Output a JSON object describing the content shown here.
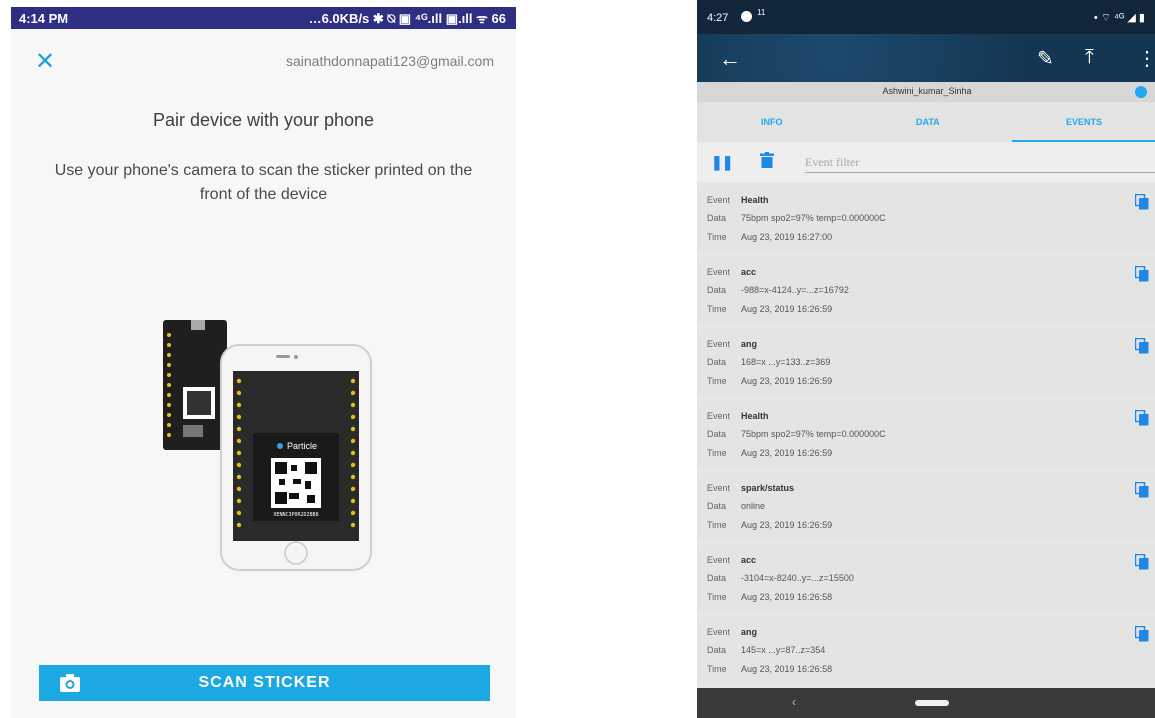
{
  "left_screen": {
    "status_bar": {
      "time": "4:14 PM",
      "right": "…6.0KB/s ✱ ⍉ ▣ ⁴ᴳ.ıll ▣.ıll ᯤ 66"
    },
    "account_email": "sainathdonnapati123@gmail.com",
    "title": "Pair device with your phone",
    "description": "Use your phone's camera to scan the sticker printed on the front of the device",
    "illustration": {
      "brand": "Particle",
      "code": "XENNC3P0R2D2BB8"
    },
    "scan_button_label": "SCAN STICKER",
    "accent": "#1ca8e3"
  },
  "right_screen": {
    "status_bar": {
      "time": "4:27",
      "mini": "11"
    },
    "device_name": "Ashwini_kumar_Sinha",
    "tabs": [
      "INFO",
      "DATA",
      "EVENTS"
    ],
    "active_tab": "EVENTS",
    "filter_placeholder": "Event filter",
    "labels": {
      "event": "Event",
      "data": "Data",
      "time": "Time"
    },
    "events": [
      {
        "event": "Health",
        "data": "75bpm spo2=97%  temp=0.000000C",
        "time": "Aug 23, 2019 16:27:00"
      },
      {
        "event": "acc",
        "data": "-988=x-4124..y=...z=16792",
        "time": "Aug 23, 2019 16:26:59"
      },
      {
        "event": "ang",
        "data": "168=x ...y=133..z=369",
        "time": "Aug 23, 2019 16:26:59"
      },
      {
        "event": "Health",
        "data": "75bpm spo2=97%  temp=0.000000C",
        "time": "Aug 23, 2019 16:26:59"
      },
      {
        "event": "spark/status",
        "data": "online",
        "time": "Aug 23, 2019 16:26:59"
      },
      {
        "event": "acc",
        "data": "-3104=x-8240..y=...z=15500",
        "time": "Aug 23, 2019 16:26:58"
      },
      {
        "event": "ang",
        "data": "145=x ...y=87..z=354",
        "time": "Aug 23, 2019 16:26:58"
      }
    ],
    "accent": "#22a7f0"
  }
}
